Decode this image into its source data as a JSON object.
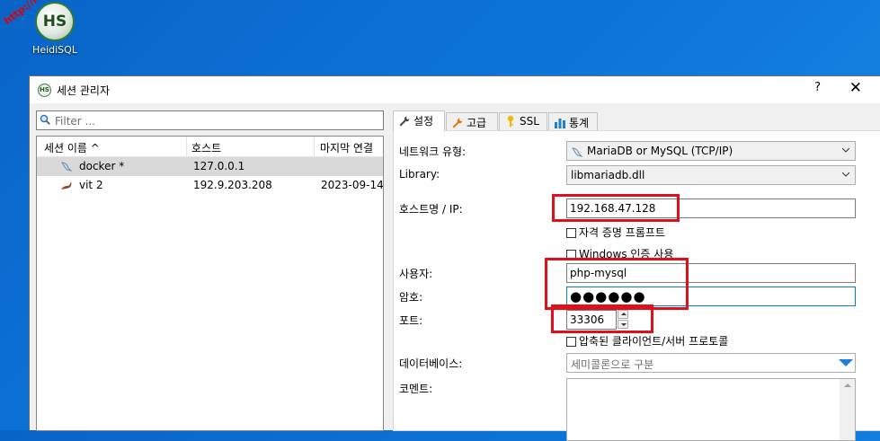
{
  "desktop": {
    "icon_label": "HeidiSQL",
    "logo_text": "HS",
    "watermark": "http://hp-h.net/"
  },
  "window": {
    "title": "세션 관리자",
    "help_label": "?",
    "close_label": "✕"
  },
  "filter": {
    "placeholder": "Filter ..."
  },
  "session_list": {
    "columns": [
      "세션 이름 ^",
      "호스트",
      "마지막 연결"
    ],
    "rows": [
      {
        "name": "docker *",
        "host": "127.0.0.1",
        "last": "",
        "selected": true
      },
      {
        "name": "vit 2",
        "host": "192.9.203.208",
        "last": "2023-09-14",
        "selected": false
      }
    ]
  },
  "tabs": [
    {
      "label": "설정",
      "icon": "wrench-icon",
      "active": true
    },
    {
      "label": "고급",
      "icon": "wrench-icon",
      "active": false
    },
    {
      "label": "SSL",
      "icon": "key-icon",
      "active": false
    },
    {
      "label": "통계",
      "icon": "bar-chart-icon",
      "active": false
    }
  ],
  "settings": {
    "network_type_label": "네트워크 유형:",
    "network_type_value": "MariaDB or MySQL (TCP/IP)",
    "library_label": "Library:",
    "library_value": "libmariadb.dll",
    "host_label": "호스트명 / IP:",
    "host_value": "192.168.47.128",
    "prompt_credentials_label": "자격 증명 프롬프트",
    "windows_auth_label": "Windows 인증 사용",
    "user_label": "사용자:",
    "user_value": "php-mysql",
    "password_label": "암호:",
    "password_value": "●●●●●●",
    "port_label": "포트:",
    "port_value": "33306",
    "compression_label": "압축된 클라이언트/서버 프로토콜",
    "database_label": "데이터베이스:",
    "database_placeholder": "세미콜론으로 구분",
    "comment_label": "코멘트:"
  },
  "colors": {
    "highlight": "#e0101a",
    "selection": "#d9d9d9",
    "focus_border": "#0a7dbd",
    "desktop": "#0b74d8"
  }
}
